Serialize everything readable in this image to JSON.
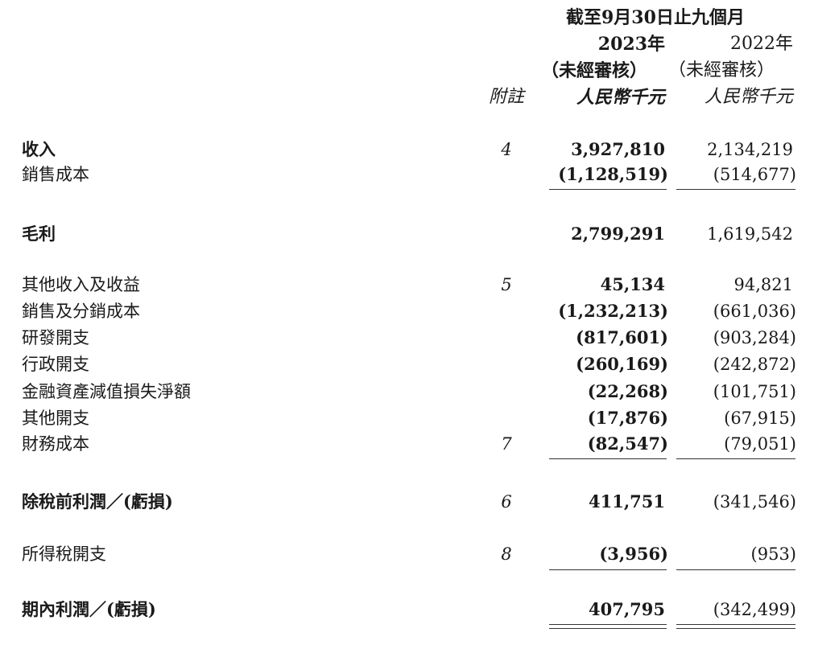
{
  "header": {
    "period": "截至9月30日止九個月",
    "year_2023": "2023年",
    "year_2022": "2022年",
    "audit_2023": "（未經審核）",
    "audit_2022": "（未經審核）",
    "notes_label": "附註",
    "unit_2023": "人民幣千元",
    "unit_2022": "人民幣千元"
  },
  "rows": [
    {
      "label": "收入",
      "note": "4",
      "v2023": "3,927,810",
      "v2022": "2,134,219"
    },
    {
      "label": "銷售成本",
      "note": "",
      "v2023": "(1,128,519)",
      "v2022": "(514,677)"
    },
    {
      "label": "毛利",
      "note": "",
      "v2023": "2,799,291",
      "v2022": "1,619,542"
    },
    {
      "label": "其他收入及收益",
      "note": "5",
      "v2023": "45,134",
      "v2022": "94,821"
    },
    {
      "label": "銷售及分銷成本",
      "note": "",
      "v2023": "(1,232,213)",
      "v2022": "(661,036)"
    },
    {
      "label": "研發開支",
      "note": "",
      "v2023": "(817,601)",
      "v2022": "(903,284)"
    },
    {
      "label": "行政開支",
      "note": "",
      "v2023": "(260,169)",
      "v2022": "(242,872)"
    },
    {
      "label": "金融資產減值損失淨額",
      "note": "",
      "v2023": "(22,268)",
      "v2022": "(101,751)"
    },
    {
      "label": "其他開支",
      "note": "",
      "v2023": "(17,876)",
      "v2022": "(67,915)"
    },
    {
      "label": "財務成本",
      "note": "7",
      "v2023": "(82,547)",
      "v2022": "(79,051)"
    },
    {
      "label": "除稅前利潤／(虧損)",
      "note": "6",
      "v2023": "411,751",
      "v2022": "(341,546)"
    },
    {
      "label": "所得稅開支",
      "note": "8",
      "v2023": "(3,956)",
      "v2022": "(953)"
    },
    {
      "label": "期內利潤／(虧損)",
      "note": "",
      "v2023": "407,795",
      "v2022": "(342,499)"
    }
  ]
}
